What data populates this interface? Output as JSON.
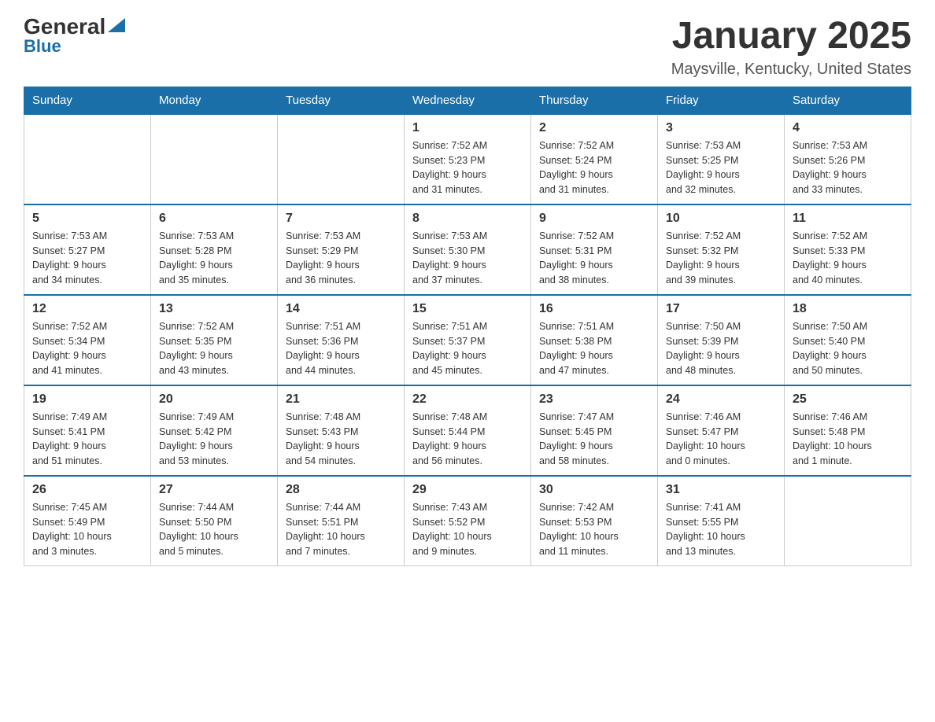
{
  "header": {
    "logo_general": "General",
    "logo_blue": "Blue",
    "month_title": "January 2025",
    "location": "Maysville, Kentucky, United States"
  },
  "weekdays": [
    "Sunday",
    "Monday",
    "Tuesday",
    "Wednesday",
    "Thursday",
    "Friday",
    "Saturday"
  ],
  "weeks": [
    [
      {
        "day": "",
        "info": ""
      },
      {
        "day": "",
        "info": ""
      },
      {
        "day": "",
        "info": ""
      },
      {
        "day": "1",
        "info": "Sunrise: 7:52 AM\nSunset: 5:23 PM\nDaylight: 9 hours\nand 31 minutes."
      },
      {
        "day": "2",
        "info": "Sunrise: 7:52 AM\nSunset: 5:24 PM\nDaylight: 9 hours\nand 31 minutes."
      },
      {
        "day": "3",
        "info": "Sunrise: 7:53 AM\nSunset: 5:25 PM\nDaylight: 9 hours\nand 32 minutes."
      },
      {
        "day": "4",
        "info": "Sunrise: 7:53 AM\nSunset: 5:26 PM\nDaylight: 9 hours\nand 33 minutes."
      }
    ],
    [
      {
        "day": "5",
        "info": "Sunrise: 7:53 AM\nSunset: 5:27 PM\nDaylight: 9 hours\nand 34 minutes."
      },
      {
        "day": "6",
        "info": "Sunrise: 7:53 AM\nSunset: 5:28 PM\nDaylight: 9 hours\nand 35 minutes."
      },
      {
        "day": "7",
        "info": "Sunrise: 7:53 AM\nSunset: 5:29 PM\nDaylight: 9 hours\nand 36 minutes."
      },
      {
        "day": "8",
        "info": "Sunrise: 7:53 AM\nSunset: 5:30 PM\nDaylight: 9 hours\nand 37 minutes."
      },
      {
        "day": "9",
        "info": "Sunrise: 7:52 AM\nSunset: 5:31 PM\nDaylight: 9 hours\nand 38 minutes."
      },
      {
        "day": "10",
        "info": "Sunrise: 7:52 AM\nSunset: 5:32 PM\nDaylight: 9 hours\nand 39 minutes."
      },
      {
        "day": "11",
        "info": "Sunrise: 7:52 AM\nSunset: 5:33 PM\nDaylight: 9 hours\nand 40 minutes."
      }
    ],
    [
      {
        "day": "12",
        "info": "Sunrise: 7:52 AM\nSunset: 5:34 PM\nDaylight: 9 hours\nand 41 minutes."
      },
      {
        "day": "13",
        "info": "Sunrise: 7:52 AM\nSunset: 5:35 PM\nDaylight: 9 hours\nand 43 minutes."
      },
      {
        "day": "14",
        "info": "Sunrise: 7:51 AM\nSunset: 5:36 PM\nDaylight: 9 hours\nand 44 minutes."
      },
      {
        "day": "15",
        "info": "Sunrise: 7:51 AM\nSunset: 5:37 PM\nDaylight: 9 hours\nand 45 minutes."
      },
      {
        "day": "16",
        "info": "Sunrise: 7:51 AM\nSunset: 5:38 PM\nDaylight: 9 hours\nand 47 minutes."
      },
      {
        "day": "17",
        "info": "Sunrise: 7:50 AM\nSunset: 5:39 PM\nDaylight: 9 hours\nand 48 minutes."
      },
      {
        "day": "18",
        "info": "Sunrise: 7:50 AM\nSunset: 5:40 PM\nDaylight: 9 hours\nand 50 minutes."
      }
    ],
    [
      {
        "day": "19",
        "info": "Sunrise: 7:49 AM\nSunset: 5:41 PM\nDaylight: 9 hours\nand 51 minutes."
      },
      {
        "day": "20",
        "info": "Sunrise: 7:49 AM\nSunset: 5:42 PM\nDaylight: 9 hours\nand 53 minutes."
      },
      {
        "day": "21",
        "info": "Sunrise: 7:48 AM\nSunset: 5:43 PM\nDaylight: 9 hours\nand 54 minutes."
      },
      {
        "day": "22",
        "info": "Sunrise: 7:48 AM\nSunset: 5:44 PM\nDaylight: 9 hours\nand 56 minutes."
      },
      {
        "day": "23",
        "info": "Sunrise: 7:47 AM\nSunset: 5:45 PM\nDaylight: 9 hours\nand 58 minutes."
      },
      {
        "day": "24",
        "info": "Sunrise: 7:46 AM\nSunset: 5:47 PM\nDaylight: 10 hours\nand 0 minutes."
      },
      {
        "day": "25",
        "info": "Sunrise: 7:46 AM\nSunset: 5:48 PM\nDaylight: 10 hours\nand 1 minute."
      }
    ],
    [
      {
        "day": "26",
        "info": "Sunrise: 7:45 AM\nSunset: 5:49 PM\nDaylight: 10 hours\nand 3 minutes."
      },
      {
        "day": "27",
        "info": "Sunrise: 7:44 AM\nSunset: 5:50 PM\nDaylight: 10 hours\nand 5 minutes."
      },
      {
        "day": "28",
        "info": "Sunrise: 7:44 AM\nSunset: 5:51 PM\nDaylight: 10 hours\nand 7 minutes."
      },
      {
        "day": "29",
        "info": "Sunrise: 7:43 AM\nSunset: 5:52 PM\nDaylight: 10 hours\nand 9 minutes."
      },
      {
        "day": "30",
        "info": "Sunrise: 7:42 AM\nSunset: 5:53 PM\nDaylight: 10 hours\nand 11 minutes."
      },
      {
        "day": "31",
        "info": "Sunrise: 7:41 AM\nSunset: 5:55 PM\nDaylight: 10 hours\nand 13 minutes."
      },
      {
        "day": "",
        "info": ""
      }
    ]
  ]
}
